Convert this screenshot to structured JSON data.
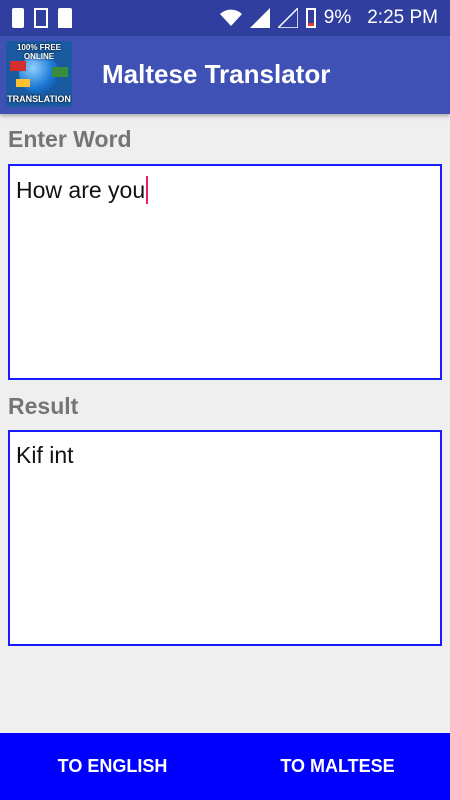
{
  "status_bar": {
    "battery": "9%",
    "time": "2:25 PM",
    "icons": [
      "notification-icon",
      "file-icon",
      "sd-card-icon",
      "wifi-icon",
      "signal-icon",
      "signal-empty-icon",
      "battery-icon"
    ]
  },
  "app_bar": {
    "title": "Maltese Translator",
    "logo_text_top": "100% FREE ONLINE",
    "logo_text_bottom": "TRANSLATION"
  },
  "input": {
    "label": "Enter Word",
    "value": "How are you"
  },
  "result": {
    "label": "Result",
    "value": "Kif int"
  },
  "buttons": {
    "to_english": "TO ENGLISH",
    "to_maltese": "TO MALTESE"
  },
  "colors": {
    "status_bar": "#303f9f",
    "app_bar": "#3f51b5",
    "field_border": "#1a1aff",
    "bottom_bar": "#0000ff",
    "cursor": "#e91e63"
  }
}
